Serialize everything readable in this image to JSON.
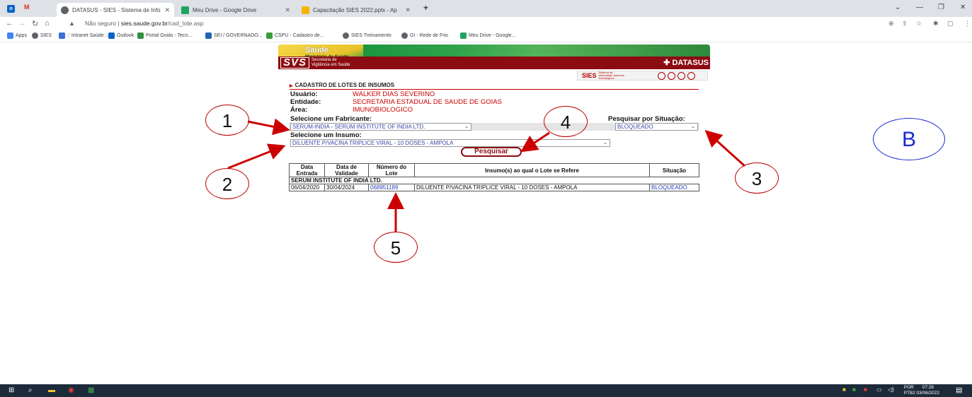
{
  "browser": {
    "tabs": [
      {
        "label": "DATASUS - SIES - Sistema de Info",
        "active": true
      },
      {
        "label": "Meu Drive - Google Drive",
        "active": false
      },
      {
        "label": "Capacitação SIES 2022.pptx - Ap",
        "active": false
      }
    ],
    "new_tab": "+",
    "not_secure": "Não seguro",
    "url_host": "sies.saude.gov.br",
    "url_path": "/cad_lote.asp",
    "bookmarks": [
      {
        "label": "Apps"
      },
      {
        "label": "SIES"
      },
      {
        "label": ":: Intranet Saúde ::"
      },
      {
        "label": "Outlook"
      },
      {
        "label": "Portal Goiás - Tecn..."
      },
      {
        "label": "SEI / GOVERNADO..."
      },
      {
        "label": "CSPU - Cadastro de..."
      },
      {
        "label": "SIES Treinamento"
      },
      {
        "label": "GI - Rede de Frio"
      },
      {
        "label": "Meu Drive - Google..."
      }
    ]
  },
  "banner": {
    "saude": "Saúde",
    "ministerio": "Ministério da Saúde",
    "svs": "SVS",
    "svs_sub1": "Secretaria de",
    "svs_sub2": "Vigilância em Saúde",
    "datasus": "DATASUS",
    "sies": "SIES",
    "sies_sub": "Sistema de Informação Insumos Estratégicos"
  },
  "form": {
    "title": "CADASTRO DE LOTES DE INSUMOS",
    "usuario_label": "Usuário:",
    "usuario_value": "WALKER DIAS SEVERINO",
    "entidade_label": "Entidade:",
    "entidade_value": "SECRETARIA ESTADUAL DE SAUDE DE GOIAS",
    "area_label": "Área:",
    "area_value": "IMUNOBIOLOGICO",
    "fabricante_label": "Selecione um Fabricante:",
    "fabricante_value": "SERUM-INDIA - SERUM INSTITUTE OF INDIA LTD.",
    "situacao_label": "Pesquisar por Situação:",
    "situacao_value": "BLOQUEADO",
    "insumo_label": "Selecione um Insumo:",
    "insumo_value": "DILUENTE P/VACINA TRIPLICE VIRAL - 10 DOSES - AMPOLA",
    "pesquisar": "Pesquisar"
  },
  "table": {
    "headers": [
      "Data Entrada",
      "Data de Validade",
      "Número do Lote",
      "Insumo(s) ao qual o Lote se Refere",
      "Situação"
    ],
    "group": "SERUM INSTITUTE OF INDIA LTD.",
    "rows": [
      [
        "06/04/2020",
        "30/04/2024",
        "068951189",
        "DILUENTE P/VACINA TRIPLICE VIRAL - 10 DOSES - AMPOLA",
        "BLOQUEADO"
      ]
    ]
  },
  "callouts": [
    "1",
    "2",
    "3",
    "4",
    "5"
  ],
  "badge": "B",
  "taskbar": {
    "lang1": "POR",
    "lang2": "PTB2",
    "time": "07:28",
    "date": "03/06/2022"
  },
  "colors": {
    "brand_red": "#8b0c12",
    "value_red": "#cc0000",
    "link_blue": "#2b3fb0",
    "badge_blue": "#1a2bd1"
  }
}
